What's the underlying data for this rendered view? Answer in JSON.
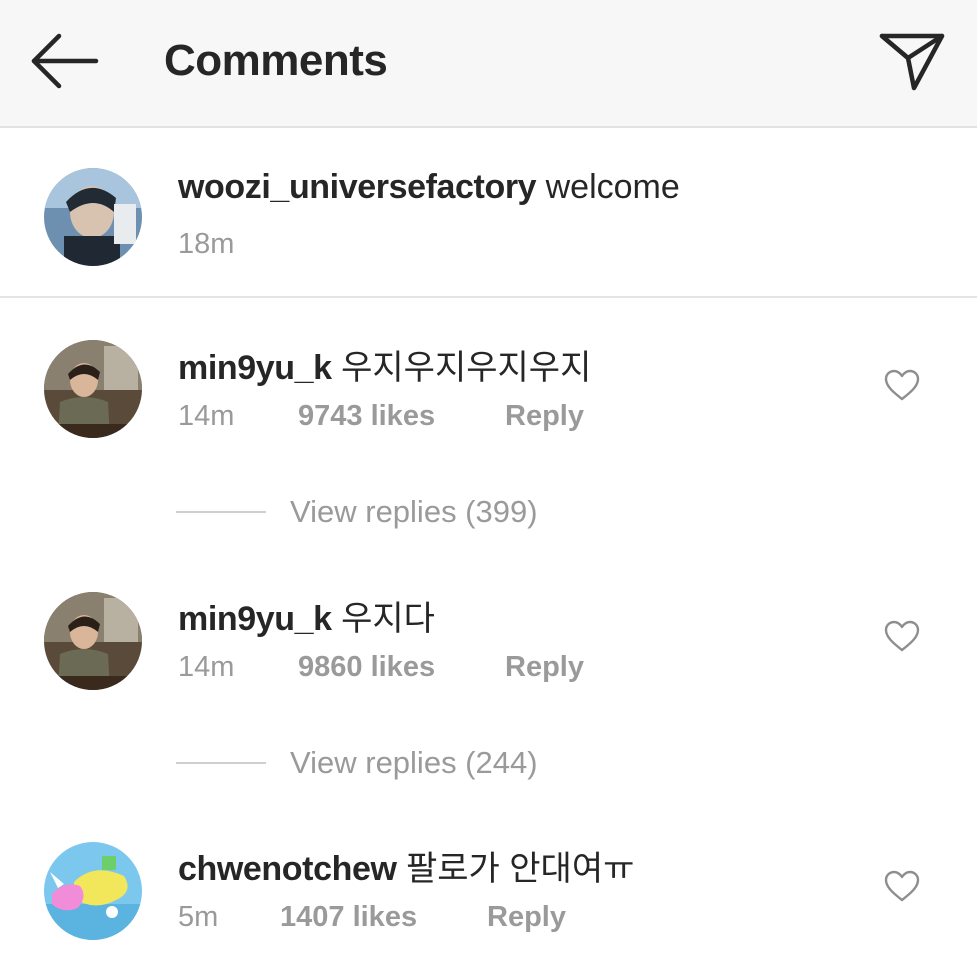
{
  "header": {
    "title": "Comments",
    "back_icon": "arrow-left-icon",
    "send_icon": "paper-plane-icon"
  },
  "caption": {
    "username": "woozi_universefactory",
    "text": "welcome",
    "time": "18m"
  },
  "comments": [
    {
      "username": "min9yu_k",
      "text": "우지우지우지우지",
      "time": "14m",
      "likes": "9743 likes",
      "reply_label": "Reply",
      "view_replies": "View replies (399)"
    },
    {
      "username": "min9yu_k",
      "text": "우지다",
      "time": "14m",
      "likes": "9860 likes",
      "reply_label": "Reply",
      "view_replies": "View replies (244)"
    },
    {
      "username": "chwenotchew",
      "text": "팔로가 안대여ㅠ",
      "time": "5m",
      "likes": "1407 likes",
      "reply_label": "Reply"
    }
  ],
  "colors": {
    "text_primary": "#262626",
    "text_secondary": "#9a9a9a",
    "header_bg": "#f7f7f7",
    "divider": "#e2e2e2"
  }
}
